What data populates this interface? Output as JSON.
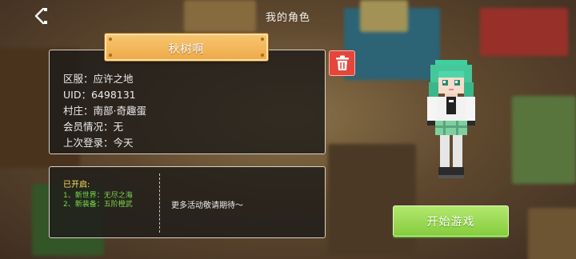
{
  "header": {
    "title": "我的角色",
    "back_icon": "chevron-left-icon"
  },
  "character": {
    "name": "秋树啊",
    "info": [
      {
        "label": "区服：应许之地"
      },
      {
        "label": "UID：6498131"
      },
      {
        "label": "村庄：南部·奇趣蛋"
      },
      {
        "label": "会员情况：无"
      },
      {
        "label": "上次登录：今天"
      }
    ]
  },
  "delete_button": {
    "icon": "trash-icon"
  },
  "unlocked": {
    "title": "已开启:",
    "items": [
      "1、新世界：无尽之海",
      "2、新装备：五阶橙武"
    ],
    "more": "更多活动敬请期待～"
  },
  "start_button": {
    "label": "开始游戏"
  },
  "colors": {
    "banner": "#f3b657",
    "delete": "#e5453b",
    "start": "#9ad954",
    "unlock_title": "#ffe45c",
    "unlock_items": "#79d94f"
  }
}
